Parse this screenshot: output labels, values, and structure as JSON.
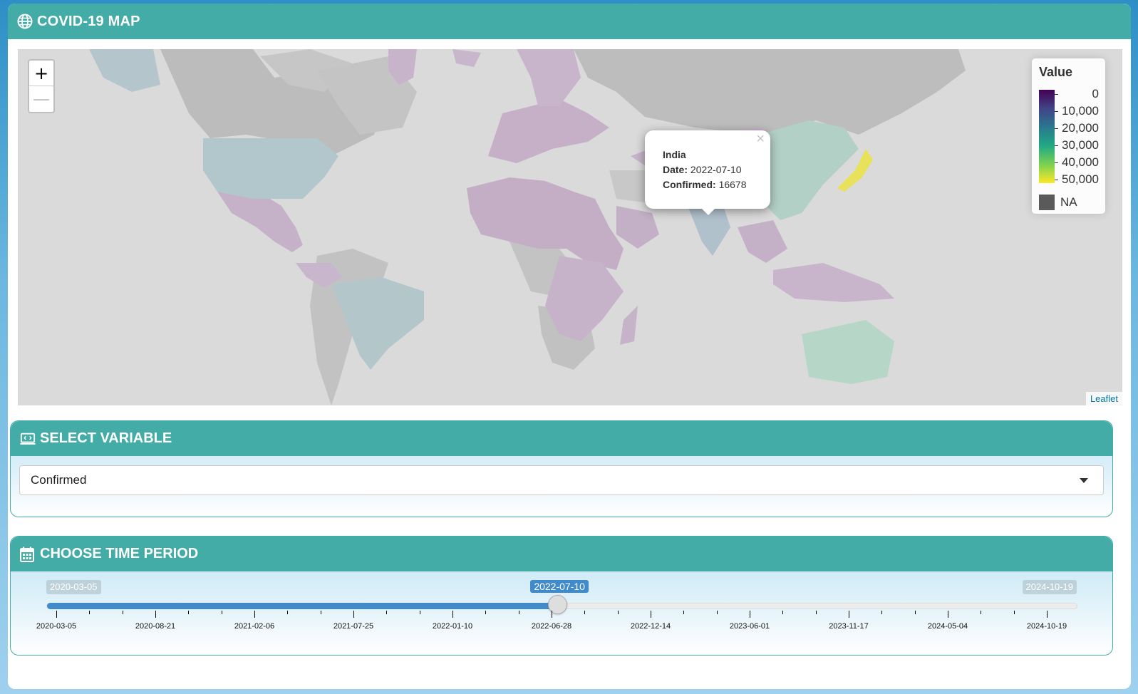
{
  "header": {
    "title": "COVID-19 MAP",
    "icon": "globe-icon"
  },
  "map": {
    "zoom_in_label": "+",
    "zoom_out_label": "—",
    "attribution": "Leaflet",
    "legend": {
      "title": "Value",
      "labels": [
        "0",
        "10,000",
        "20,000",
        "30,000",
        "40,000",
        "50,000"
      ],
      "na_label": "NA",
      "colors": [
        "#440154",
        "#414487",
        "#2a788e",
        "#22a884",
        "#7ad151",
        "#fde725"
      ],
      "na_color": "#5a5a5a"
    },
    "popup": {
      "country": "India",
      "date_label": "Date:",
      "date_value": "2022-07-10",
      "confirmed_label": "Confirmed:",
      "confirmed_value": "16678",
      "close": "×"
    }
  },
  "select_variable": {
    "title": "SELECT VARIABLE",
    "icon": "code-display-icon",
    "selected": "Confirmed"
  },
  "time_period": {
    "title": "CHOOSE TIME PERIOD",
    "icon": "calendar-icon",
    "min": "2020-03-05",
    "max": "2024-10-19",
    "value": "2022-07-10",
    "value_fraction": 0.506,
    "tick_labels": [
      "2020-03-05",
      "2020-08-21",
      "2021-02-06",
      "2021-07-25",
      "2022-01-10",
      "2022-06-28",
      "2022-12-14",
      "2023-06-01",
      "2023-11-17",
      "2024-05-04",
      "2024-10-19"
    ]
  },
  "colors": {
    "header": "#43aca6",
    "slider": "#428bca"
  }
}
